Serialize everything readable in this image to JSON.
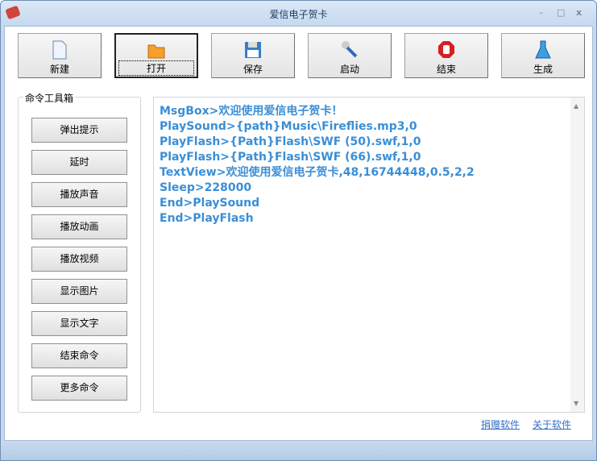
{
  "window": {
    "title": "爱信电子贺卡",
    "minimize": "–",
    "maximize": "□",
    "close": "x"
  },
  "toolbar": [
    {
      "label": "新建",
      "icon": "new-file-icon"
    },
    {
      "label": "打开",
      "icon": "folder-icon"
    },
    {
      "label": "保存",
      "icon": "save-icon"
    },
    {
      "label": "启动",
      "icon": "wrench-icon"
    },
    {
      "label": "结束",
      "icon": "stop-icon"
    },
    {
      "label": "生成",
      "icon": "flask-icon"
    }
  ],
  "toolbox": {
    "title": "命令工具箱",
    "commands": [
      "弹出提示",
      "延时",
      "播放声音",
      "播放动画",
      "播放视频",
      "显示图片",
      "显示文字",
      "结束命令",
      "更多命令"
    ]
  },
  "editor": {
    "lines": [
      "MsgBox>欢迎使用爱信电子贺卡！",
      "PlaySound>{path}Music\\Fireflies.mp3,0",
      "PlayFlash>{Path}Flash\\SWF (50).swf,1,0",
      "PlayFlash>{Path}Flash\\SWF (66).swf,1,0",
      "TextView>欢迎使用爱信电子贺卡,48,16744448,0.5,2,2",
      "Sleep>228000",
      "End>PlaySound",
      "End>PlayFlash"
    ]
  },
  "links": {
    "donate": "捐赠软件",
    "about": "关于软件"
  }
}
